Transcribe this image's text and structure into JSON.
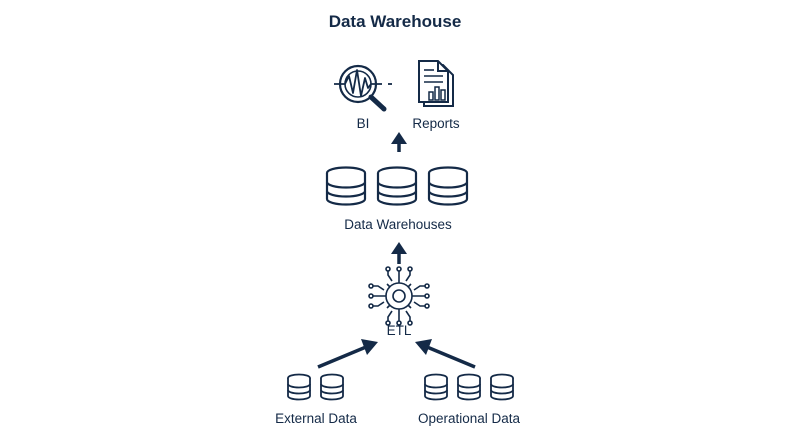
{
  "title": "Data Warehouse",
  "colors": {
    "ink": "#142a47",
    "background": "#ffffff"
  },
  "nodes": {
    "bi": {
      "label": "BI",
      "icon": "magnifier-waveform-icon"
    },
    "reports": {
      "label": "Reports",
      "icon": "report-document-icon"
    },
    "warehouses": {
      "label": "Data Warehouses",
      "icon": "database-icon"
    },
    "etl": {
      "label": "ETL",
      "icon": "circuit-gear-icon"
    },
    "external": {
      "label": "External Data",
      "icon": "database-icon"
    },
    "operational": {
      "label": "Operational Data",
      "icon": "database-icon"
    }
  }
}
